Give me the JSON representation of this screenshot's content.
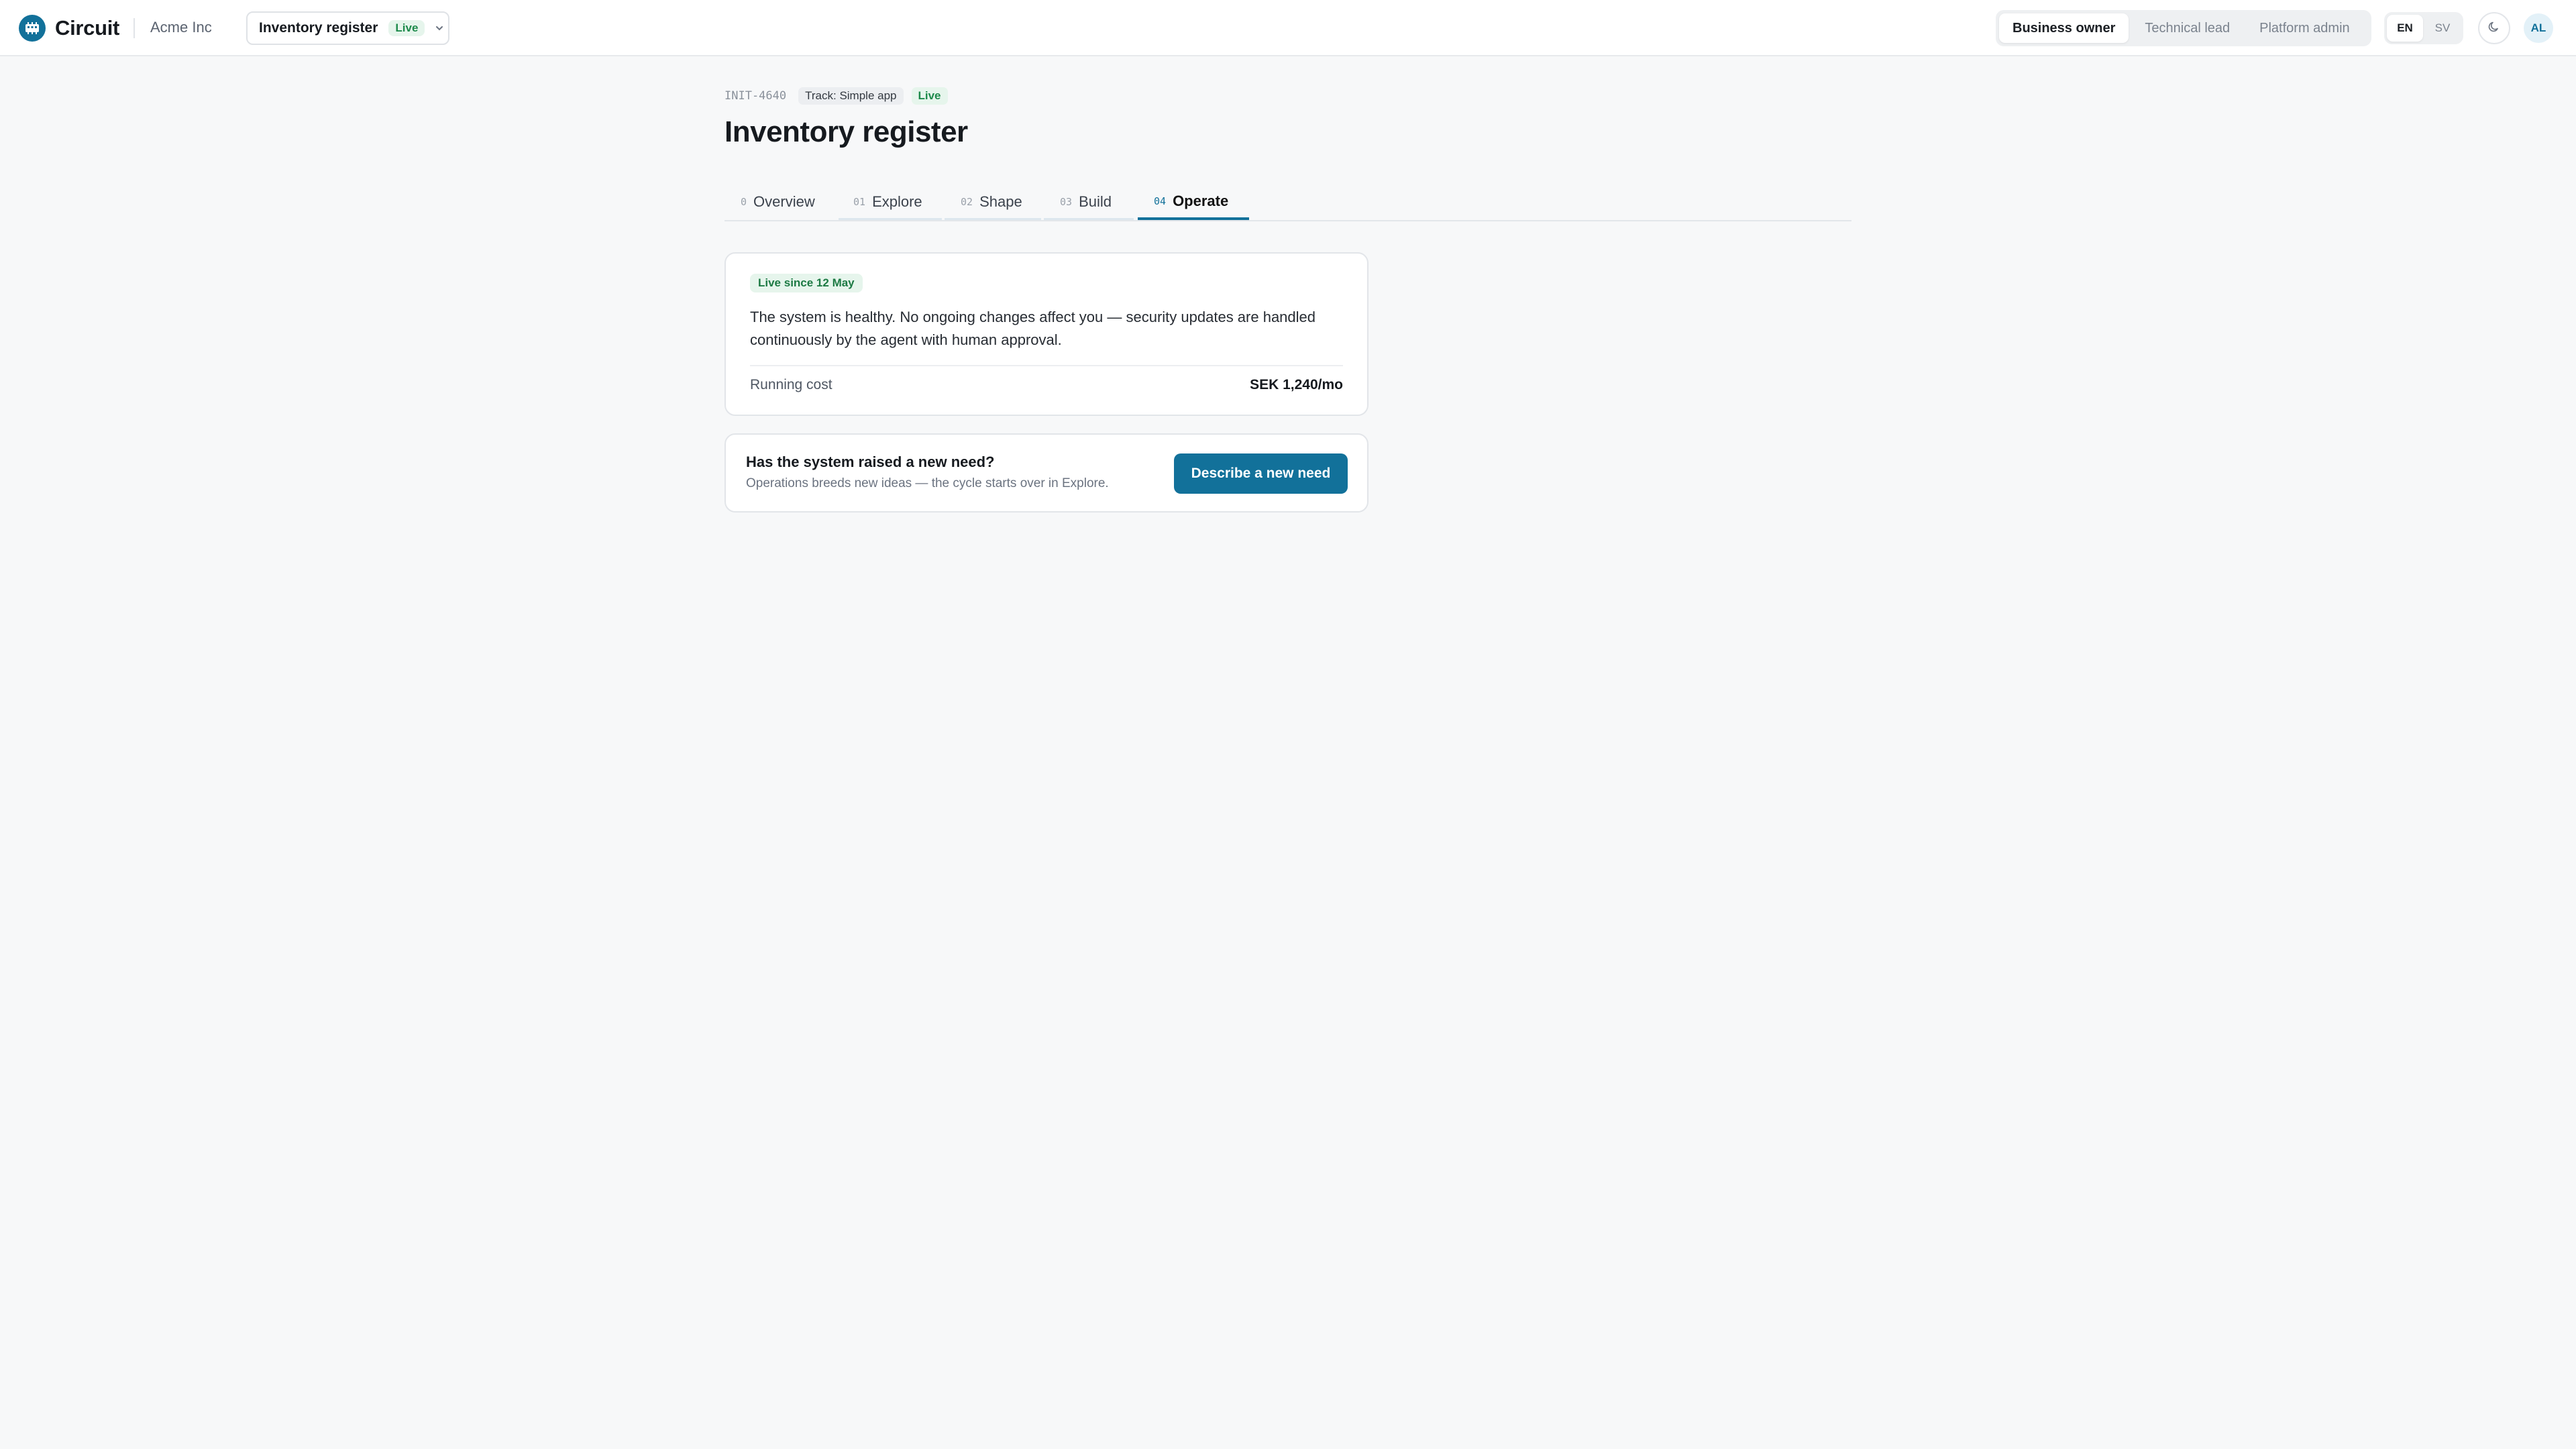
{
  "brand": {
    "name": "Circuit",
    "icon": "circuit-logo-icon"
  },
  "org": {
    "name": "Acme Inc"
  },
  "project_selector": {
    "name": "Inventory register",
    "status": "Live",
    "icon": "chevron-down-icon"
  },
  "roles": [
    {
      "label": "Business owner",
      "active": true
    },
    {
      "label": "Technical lead",
      "active": false
    },
    {
      "label": "Platform admin",
      "active": false
    }
  ],
  "languages": [
    {
      "label": "EN",
      "active": true
    },
    {
      "label": "SV",
      "active": false
    }
  ],
  "theme_toggle": {
    "icon": "moon-icon"
  },
  "user": {
    "initials": "AL"
  },
  "header": {
    "id": "INIT-4640",
    "track": "Track: Simple app",
    "status": "Live",
    "title": "Inventory register"
  },
  "tabs": [
    {
      "num": "0",
      "label": "Overview",
      "active": false
    },
    {
      "num": "01",
      "label": "Explore",
      "active": false
    },
    {
      "num": "02",
      "label": "Shape",
      "active": false
    },
    {
      "num": "03",
      "label": "Build",
      "active": false
    },
    {
      "num": "04",
      "label": "Operate",
      "active": true
    }
  ],
  "status_card": {
    "badge": "Live since 12 May",
    "text": "The system is healthy. No ongoing changes affect you — security updates are handled continuously by the agent with human approval.",
    "cost_label": "Running cost",
    "cost_value": "SEK 1,240/mo"
  },
  "need_card": {
    "title": "Has the system raised a new need?",
    "subtitle": "Operations breeds new ideas — the cycle starts over in Explore.",
    "button": "Describe a new need"
  },
  "colors": {
    "accent": "#12719a",
    "live_green": "#1d8a4b",
    "background": "#f7f8f9"
  }
}
